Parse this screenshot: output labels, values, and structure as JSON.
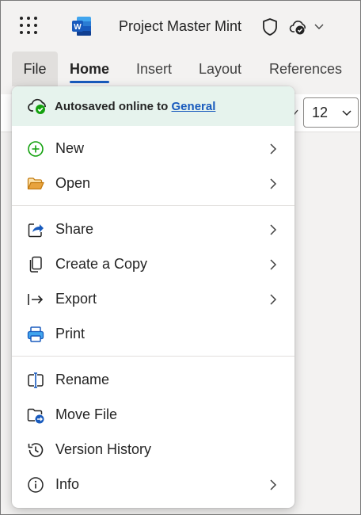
{
  "titlebar": {
    "app_icon": "waffle-icon",
    "word_logo": "word-logo",
    "doc_title": "Project Master Mint",
    "shield_icon": "shield-icon",
    "cloud_icon": "cloud-check-icon"
  },
  "tabs": [
    {
      "label": "File",
      "active": false
    },
    {
      "label": "Home",
      "active": true
    },
    {
      "label": "Insert",
      "active": false
    },
    {
      "label": "Layout",
      "active": false
    },
    {
      "label": "References",
      "active": false
    }
  ],
  "ribbon": {
    "font_size": "12"
  },
  "menu": {
    "autosave": {
      "prefix": "Autosaved online to ",
      "location": "General"
    },
    "items": [
      {
        "label": "New",
        "icon": "plus-circle-icon",
        "submenu": true
      },
      {
        "label": "Open",
        "icon": "folder-open-icon",
        "submenu": true
      },
      {
        "label": "Share",
        "icon": "share-icon",
        "submenu": true
      },
      {
        "label": "Create a Copy",
        "icon": "copy-icon",
        "submenu": true
      },
      {
        "label": "Export",
        "icon": "export-icon",
        "submenu": true
      },
      {
        "label": "Print",
        "icon": "print-icon",
        "submenu": false
      },
      {
        "label": "Rename",
        "icon": "rename-icon",
        "submenu": false
      },
      {
        "label": "Move File",
        "icon": "move-file-icon",
        "submenu": false
      },
      {
        "label": "Version History",
        "icon": "history-icon",
        "submenu": false
      },
      {
        "label": "Info",
        "icon": "info-icon",
        "submenu": true
      }
    ]
  },
  "colors": {
    "accent": "#185abd",
    "autosave_bg": "#e6f3ed",
    "success": "#13a10e",
    "folder": "#e8a33d"
  }
}
